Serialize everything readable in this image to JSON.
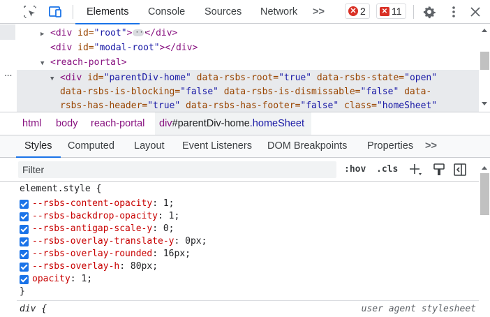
{
  "toolbar": {
    "tabs": [
      "Elements",
      "Console",
      "Sources",
      "Network"
    ],
    "more_tabs": ">>",
    "error_count": "2",
    "issue_count": "11"
  },
  "dom": {
    "line1": {
      "open": "<div",
      "attr": " id=",
      "val": "\"root\"",
      "close": ">",
      "end": "</div>"
    },
    "line2": {
      "open": "<div",
      "attr": " id=",
      "val": "\"modal-root\"",
      "close": "></div>"
    },
    "line3": {
      "open": "<reach-portal>"
    },
    "sel": {
      "open": "<div",
      "a1": " id=",
      "v1": "\"parentDiv-home\"",
      "a2": " data-rsbs-root=",
      "v2": "\"true\"",
      "a3": " data-rsbs-state=",
      "v3": "\"open\"",
      "a4": "data-rsbs-is-blocking=",
      "v4": "\"false\"",
      "a5": " data-rsbs-is-dismissable=",
      "v5": "\"false\"",
      "a6": " data-",
      "a7": "rsbs-has-header=",
      "v7": "\"true\"",
      "a8": " data-rsbs-has-footer=",
      "v8": "\"false\"",
      "a9": " class=",
      "v9": "\"homeSheet\""
    }
  },
  "breadcrumb": {
    "items": [
      "html",
      "body",
      "reach-portal"
    ],
    "active_tag": "div",
    "active_id": "#parentDiv-home",
    "active_class": ".homeSheet"
  },
  "subtabs": [
    "Styles",
    "Computed",
    "Layout",
    "Event Listeners",
    "DOM Breakpoints",
    "Properties"
  ],
  "subtabs_more": ">>",
  "filter": {
    "placeholder": "Filter",
    "hov": ":hov",
    "cls": ".cls"
  },
  "styles": {
    "selector": "element.style {",
    "close": "}",
    "properties": [
      {
        "name": "--rsbs-content-opacity",
        "value": "1"
      },
      {
        "name": "--rsbs-backdrop-opacity",
        "value": "1"
      },
      {
        "name": "--rsbs-antigap-scale-y",
        "value": "0"
      },
      {
        "name": "--rsbs-overlay-translate-y",
        "value": "0px"
      },
      {
        "name": "--rsbs-overlay-rounded",
        "value": "16px"
      },
      {
        "name": "--rsbs-overlay-h",
        "value": "80px"
      },
      {
        "name": "opacity",
        "value": "1"
      }
    ],
    "next_selector": "div {",
    "next_source": "user agent stylesheet"
  }
}
